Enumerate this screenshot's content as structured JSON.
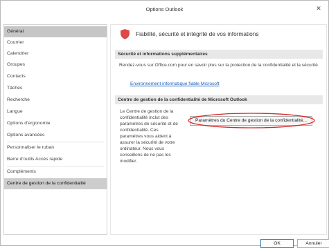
{
  "window": {
    "title": "Options Outlook",
    "close_glyph": "✕"
  },
  "sidebar": {
    "items": [
      {
        "label": "Général"
      },
      {
        "label": "Courrier"
      },
      {
        "label": "Calendrier"
      },
      {
        "label": "Groupes"
      },
      {
        "label": "Contacts"
      },
      {
        "label": "Tâches"
      },
      {
        "label": "Recherche"
      },
      {
        "label": "Langue"
      },
      {
        "label": "Options d'ergonomie"
      },
      {
        "label": "Options avancées"
      },
      {
        "label": "Personnaliser le ruban"
      },
      {
        "label": "Barre d'outils Accès rapide"
      },
      {
        "label": "Compléments"
      },
      {
        "label": "Centre de gestion de la confidentialité"
      }
    ],
    "selected_index": 0,
    "active_index": 13
  },
  "main": {
    "header_icon": "shield-icon",
    "header_text": "Fiabilité, sécurité et intégrité de vos informations",
    "security_section": {
      "title": "Sécurité et informations supplémentaires",
      "description": "Rendez-vous sur Office.com pour en savoir plus sur la protection de la confidentialité et la sécurité.",
      "link": "Environnement informatique fiable Microsoft"
    },
    "trust_center_section": {
      "title": "Centre de gestion de la confidentialité de Microsoft Outlook",
      "description": "Le Centre de gestion de la confidentialité inclut des paramètres de sécurité et de confidentialité. Ces paramètres vous aident à assurer la sécurité de votre ordinateur. Nous vous conseillons de ne pas les modifier.",
      "button_label": "Paramètres du Centre de gestion de la confidentialité..."
    }
  },
  "footer": {
    "ok_label": "OK",
    "cancel_label": "Annuler"
  },
  "colors": {
    "accent_link": "#1e5fb4",
    "shield_red": "#e04848",
    "annotation_red": "#d42a2a",
    "selected_bg": "#c6c6c6",
    "section_bg": "#e8e8e8"
  }
}
